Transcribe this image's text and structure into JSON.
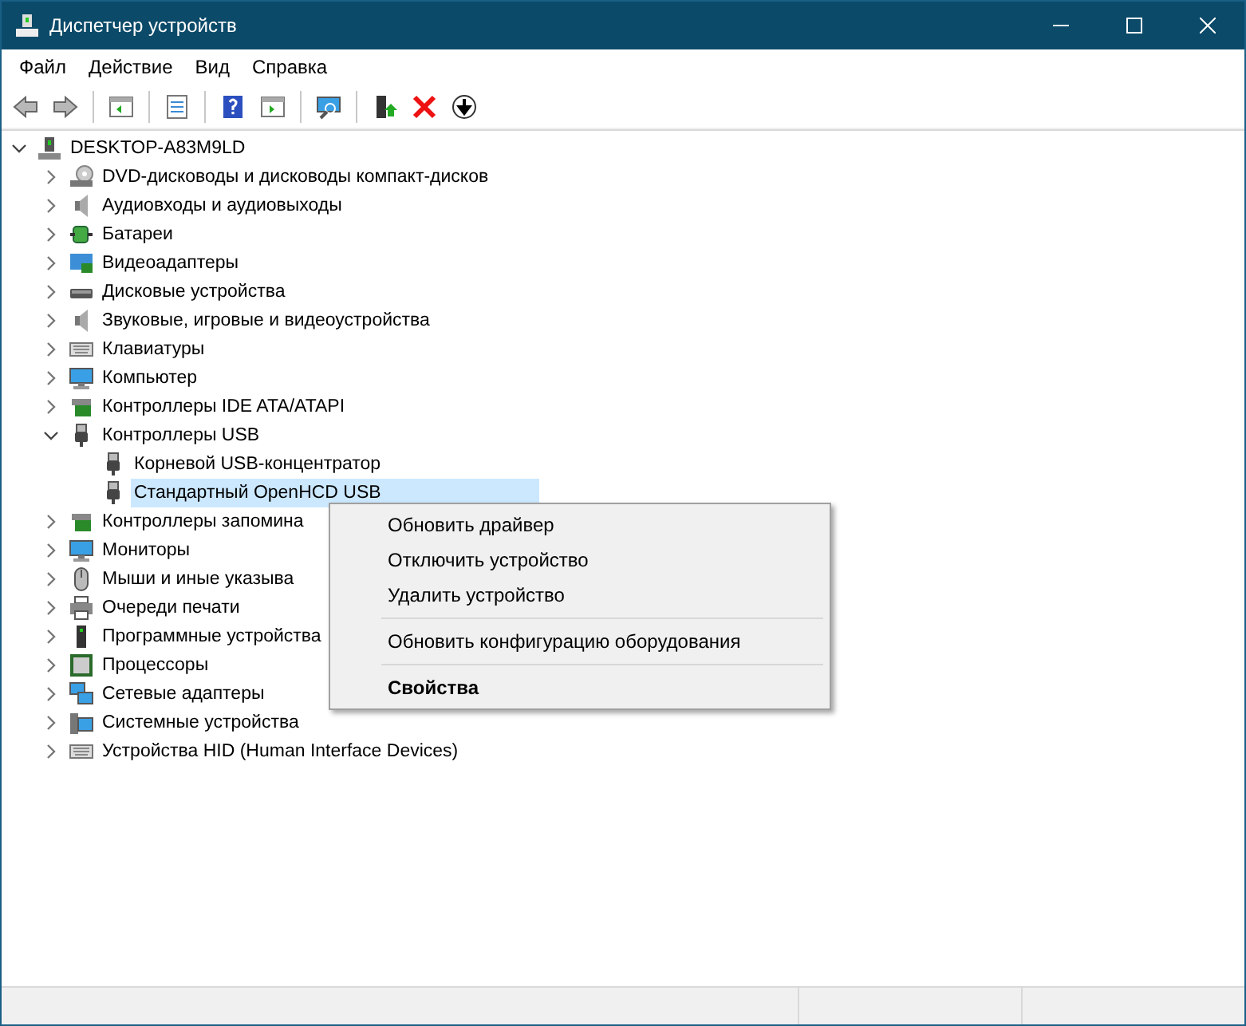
{
  "window": {
    "title": "Диспетчер устройств"
  },
  "menu": [
    "Файл",
    "Действие",
    "Вид",
    "Справка"
  ],
  "toolbar": [
    {
      "kind": "back",
      "disabled": true
    },
    {
      "kind": "forward",
      "disabled": true
    },
    {
      "kind": "sep"
    },
    {
      "kind": "pane"
    },
    {
      "kind": "sep"
    },
    {
      "kind": "properties"
    },
    {
      "kind": "sep"
    },
    {
      "kind": "help"
    },
    {
      "kind": "pane2"
    },
    {
      "kind": "sep"
    },
    {
      "kind": "scan"
    },
    {
      "kind": "sep"
    },
    {
      "kind": "update"
    },
    {
      "kind": "remove"
    },
    {
      "kind": "disable"
    }
  ],
  "tree": {
    "label": "DESKTOP-A83M9LD",
    "kind": "computer-tower",
    "expanded": true,
    "selected": false,
    "children": [
      {
        "label": "DVD-дисководы и дисководы компакт-дисков",
        "kind": "dvd",
        "expanded": false,
        "selected": false
      },
      {
        "label": "Аудиовходы и аудиовыходы",
        "kind": "speaker",
        "expanded": false,
        "selected": false
      },
      {
        "label": "Батареи",
        "kind": "battery",
        "expanded": false,
        "selected": false
      },
      {
        "label": "Видеоадаптеры",
        "kind": "display",
        "expanded": false,
        "selected": false
      },
      {
        "label": "Дисковые устройства",
        "kind": "disk",
        "expanded": false,
        "selected": false
      },
      {
        "label": "Звуковые, игровые и видеоустройства",
        "kind": "speaker",
        "expanded": false,
        "selected": false
      },
      {
        "label": "Клавиатуры",
        "kind": "keyboard",
        "expanded": false,
        "selected": false
      },
      {
        "label": "Компьютер",
        "kind": "monitor",
        "expanded": false,
        "selected": false
      },
      {
        "label": "Контроллеры IDE ATA/ATAPI",
        "kind": "card",
        "expanded": false,
        "selected": false
      },
      {
        "label": "Контроллеры USB",
        "kind": "usb",
        "expanded": true,
        "selected": false,
        "children": [
          {
            "label": "Корневой USB-концентратор",
            "kind": "usb",
            "selected": false
          },
          {
            "label": "Стандартный OpenHCD USB",
            "kind": "usb",
            "selected": true
          }
        ]
      },
      {
        "label": "Контроллеры запомина",
        "kind": "card",
        "expanded": false,
        "selected": false
      },
      {
        "label": "Мониторы",
        "kind": "monitor",
        "expanded": false,
        "selected": false
      },
      {
        "label": "Мыши и иные указыва",
        "kind": "mouse",
        "expanded": false,
        "selected": false
      },
      {
        "label": "Очереди печати",
        "kind": "printer",
        "expanded": false,
        "selected": false
      },
      {
        "label": "Программные устройства",
        "kind": "tower",
        "expanded": false,
        "selected": false
      },
      {
        "label": "Процессоры",
        "kind": "cpu",
        "expanded": false,
        "selected": false
      },
      {
        "label": "Сетевые адаптеры",
        "kind": "network",
        "expanded": false,
        "selected": false
      },
      {
        "label": "Системные устройства",
        "kind": "system",
        "expanded": false,
        "selected": false
      },
      {
        "label": "Устройства HID (Human Interface Devices)",
        "kind": "keyboard",
        "expanded": false,
        "selected": false
      }
    ]
  },
  "context_menu": [
    {
      "kind": "item",
      "label": "Обновить драйвер",
      "default": false
    },
    {
      "kind": "item",
      "label": "Отключить устройство",
      "default": false
    },
    {
      "kind": "item",
      "label": "Удалить устройство",
      "default": false
    },
    {
      "kind": "separator"
    },
    {
      "kind": "item",
      "label": "Обновить конфигурацию оборудования",
      "default": false
    },
    {
      "kind": "separator"
    },
    {
      "kind": "item",
      "label": "Свойства",
      "default": true
    }
  ]
}
